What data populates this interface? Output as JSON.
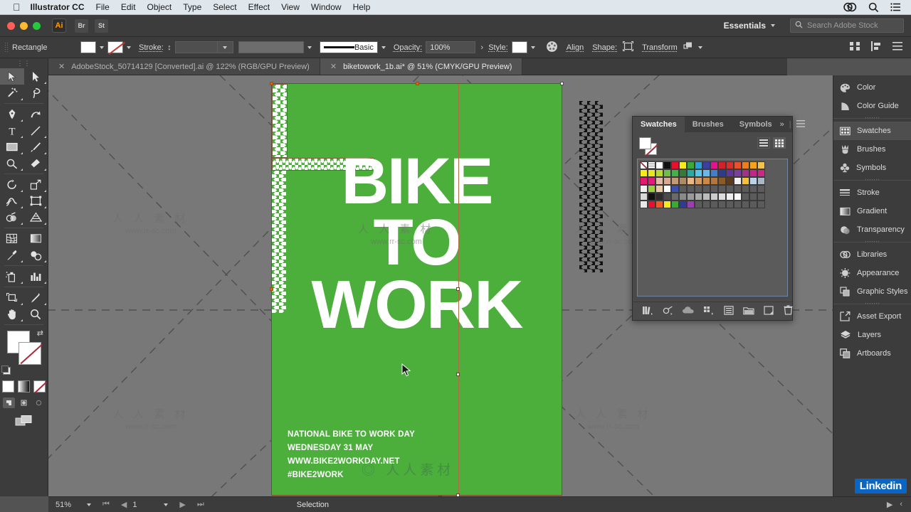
{
  "macbar": {
    "apple_icon": "apple-logo",
    "app_name": "Illustrator CC",
    "menus": [
      "File",
      "Edit",
      "Object",
      "Type",
      "Select",
      "Effect",
      "View",
      "Window",
      "Help"
    ],
    "right_icons": [
      "creative-cloud-icon",
      "search-icon",
      "list-icon"
    ]
  },
  "appbar": {
    "logo": "Ai",
    "mini_buttons": [
      "Br",
      "St"
    ],
    "workspace": "Essentials",
    "search_placeholder": "Search Adobe Stock"
  },
  "control_bar": {
    "object_label": "Rectangle",
    "fill_label": "fill-swatch",
    "stroke_label": "Stroke:",
    "stroke_weight": "",
    "brush_label": "Basic",
    "opacity_label": "Opacity:",
    "opacity_value": "100%",
    "style_label": "Style:",
    "align_label": "Align",
    "shape_label": "Shape:",
    "transform_label": "Transform",
    "more_label": "›"
  },
  "tabs": [
    {
      "title": "AdobeStock_50714129 [Converted].ai @ 122% (RGB/GPU Preview)",
      "active": false
    },
    {
      "title": "biketowork_1b.ai* @ 51% (CMYK/GPU Preview)",
      "active": true
    }
  ],
  "tools": [
    {
      "name": "selection-tool",
      "selected": true
    },
    {
      "name": "direct-selection-tool",
      "selected": false
    },
    {
      "name": "magic-wand-tool",
      "selected": false
    },
    {
      "name": "lasso-tool",
      "selected": false
    },
    {
      "name": "pen-tool",
      "selected": false
    },
    {
      "name": "curvature-tool",
      "selected": false
    },
    {
      "name": "type-tool",
      "selected": false
    },
    {
      "name": "line-segment-tool",
      "selected": false
    },
    {
      "name": "rectangle-tool",
      "selected": false
    },
    {
      "name": "paintbrush-tool",
      "selected": false
    },
    {
      "name": "shaper-tool",
      "selected": false
    },
    {
      "name": "eraser-tool",
      "selected": false
    },
    {
      "name": "rotate-tool",
      "selected": false
    },
    {
      "name": "scale-tool",
      "selected": false
    },
    {
      "name": "width-tool",
      "selected": false
    },
    {
      "name": "free-transform-tool",
      "selected": false
    },
    {
      "name": "shape-builder-tool",
      "selected": false
    },
    {
      "name": "perspective-grid-tool",
      "selected": false
    },
    {
      "name": "mesh-tool",
      "selected": false
    },
    {
      "name": "gradient-tool",
      "selected": false
    },
    {
      "name": "eyedropper-tool",
      "selected": false
    },
    {
      "name": "blend-tool",
      "selected": false
    },
    {
      "name": "symbol-sprayer-tool",
      "selected": false
    },
    {
      "name": "column-graph-tool",
      "selected": false
    },
    {
      "name": "artboard-tool",
      "selected": false
    },
    {
      "name": "slice-tool",
      "selected": false
    },
    {
      "name": "hand-tool",
      "selected": false
    },
    {
      "name": "zoom-tool",
      "selected": false
    }
  ],
  "color_controls": {
    "fill_color": "#ffffff",
    "stroke_color": "none",
    "modes": [
      "color-fill",
      "gradient-fill",
      "none-fill"
    ],
    "draw_modes": [
      "draw-normal",
      "draw-behind",
      "draw-inside"
    ]
  },
  "artwork": {
    "background_color": "#4caf3c",
    "title_lines": [
      "BIKE",
      "TO",
      "WORK"
    ],
    "info_lines": [
      "NATIONAL BIKE TO WORK DAY",
      "WEDNESDAY 31 MAY",
      "WWW.BIKE2WORKDAY.NET",
      "#BIKE2WORK"
    ]
  },
  "watermarks": {
    "top_left": "www.rr-sc.com",
    "cn": "人 人 素 材",
    "url": "www.rr-sc.com"
  },
  "swatches_panel": {
    "tabs": [
      {
        "label": "Swatches",
        "active": true
      },
      {
        "label": "Brushes",
        "active": false
      },
      {
        "label": "Symbols",
        "active": false
      }
    ],
    "overflow_icon": "chevron-double-right-icon",
    "menu_icon": "panel-menu-icon",
    "view_list_icon": "list-view-icon",
    "view_grid_icon": "grid-view-icon",
    "footer_icons": [
      "swatch-libraries-icon",
      "show-swatch-kinds-icon",
      "color-group-icon",
      "new-color-group-icon",
      "swatch-options-icon",
      "new-swatch-folder-icon",
      "new-swatch-icon",
      "delete-swatch-icon"
    ],
    "rows": [
      [
        "#ffffff",
        "#f2f2f2",
        "#ffffff",
        "#111111",
        "#e8112d",
        "#f6eb16",
        "#3aa93a",
        "#2aa0d8",
        "#3b3fa0",
        "#e8118e",
        "#d0222c",
        "#d8302c",
        "#e8512c",
        "#f07c1c",
        "#f5a31c",
        "#f2c24a"
      ],
      [
        "#f7ec1a",
        "#eae61b",
        "#b7d932",
        "#6cc04a",
        "#44b14b",
        "#2f7d38",
        "#2aa9a0",
        "#55c7e8",
        "#69b9e8",
        "#3f7fd0",
        "#2c3b8c",
        "#63359a",
        "#7b3fa0",
        "#a6318c",
        "#c4258a",
        "#d0248a"
      ],
      [
        "#e31a6d",
        "#e8187a",
        "#e3b9a8",
        "#d8a98e",
        "#c49a76",
        "#b08a62",
        "#e8b888",
        "#d79a5e",
        "#c98a46",
        "#b5763a",
        "#8a5a2a",
        "#5e3a1c",
        "#f2f2f2",
        "#f5c13a",
        "#bcd2e8",
        "#a8b8c8"
      ],
      [
        "#f0f0f0",
        "#9ccf3a",
        "#e8c9a8",
        "#ffffff",
        "#3a4fb0",
        "#5b5b5b",
        "#5b5b5b",
        "#5b5b5b",
        "#5b5b5b",
        "#5b5b5b",
        "#5b5b5b",
        "#5b5b5b",
        "#5b5b5b",
        "#5b5b5b",
        "#5b5b5b",
        "#5b5b5b"
      ],
      [
        "#d8d8d8",
        "#111111",
        "#2b2b2b",
        "#4a4a4a",
        "#6a6a6a",
        "#8a8a8a",
        "#9a9a9a",
        "#aaaaaa",
        "#bcbcbc",
        "#cccccc",
        "#dddddd",
        "#eeeeee",
        "#fafafa",
        "#5b5b5b",
        "#5b5b5b",
        "#5b5b5b"
      ],
      [
        "#e8e8e8",
        "#e8112d",
        "#f05a22",
        "#f6eb16",
        "#3aa93a",
        "#2e3b9a",
        "#9a3fb0",
        "#5b5b5b",
        "#5b5b5b",
        "#5b5b5b",
        "#5b5b5b",
        "#5b5b5b",
        "#5b5b5b",
        "#5b5b5b",
        "#5b5b5b",
        "#5b5b5b"
      ]
    ]
  },
  "dock": [
    {
      "label": "Color",
      "icon": "color-icon",
      "active": false
    },
    {
      "label": "Color Guide",
      "icon": "color-guide-icon",
      "active": false
    },
    {
      "divider": true
    },
    {
      "label": "Swatches",
      "icon": "swatches-icon",
      "active": true
    },
    {
      "label": "Brushes",
      "icon": "brushes-icon",
      "active": false
    },
    {
      "label": "Symbols",
      "icon": "symbols-icon",
      "active": false
    },
    {
      "divider": true
    },
    {
      "label": "Stroke",
      "icon": "stroke-icon",
      "active": false
    },
    {
      "label": "Gradient",
      "icon": "gradient-icon",
      "active": false
    },
    {
      "label": "Transparency",
      "icon": "transparency-icon",
      "active": false
    },
    {
      "divider": true
    },
    {
      "label": "Libraries",
      "icon": "libraries-icon",
      "active": false
    },
    {
      "label": "Appearance",
      "icon": "appearance-icon",
      "active": false
    },
    {
      "label": "Graphic Styles",
      "icon": "graphic-styles-icon",
      "active": false
    },
    {
      "divider": true
    },
    {
      "label": "Asset Export",
      "icon": "asset-export-icon",
      "active": false
    },
    {
      "label": "Layers",
      "icon": "layers-icon",
      "active": false
    },
    {
      "label": "Artboards",
      "icon": "artboards-icon",
      "active": false
    }
  ],
  "statusbar": {
    "zoom": "51%",
    "page": "1",
    "tool": "Selection"
  },
  "badge": {
    "label": "Linked",
    "suffix": "in"
  }
}
